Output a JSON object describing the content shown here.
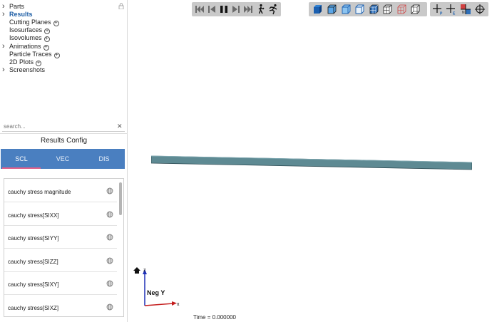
{
  "tree": [
    {
      "label": "Parts",
      "caret": true,
      "bold": false,
      "plus": false
    },
    {
      "label": "Results",
      "caret": true,
      "bold": true,
      "plus": false
    },
    {
      "label": "Cutting Planes",
      "caret": false,
      "bold": false,
      "plus": true
    },
    {
      "label": "Isosurfaces",
      "caret": false,
      "bold": false,
      "plus": true
    },
    {
      "label": "Isovolumes",
      "caret": false,
      "bold": false,
      "plus": true
    },
    {
      "label": "Animations",
      "caret": true,
      "bold": false,
      "plus": true
    },
    {
      "label": "Particle Traces",
      "caret": false,
      "bold": false,
      "plus": true
    },
    {
      "label": "2D Plots",
      "caret": false,
      "bold": false,
      "plus": true
    },
    {
      "label": "Screenshots",
      "caret": true,
      "bold": false,
      "plus": false
    }
  ],
  "search": {
    "placeholder": "search...",
    "clear": "✕"
  },
  "results_config": {
    "title": "Results Config",
    "tabs": [
      "SCL",
      "VEC",
      "DIS"
    ],
    "active_tab": "SCL",
    "items": [
      "cauchy stress magnitude",
      "cauchy stress[SIXX]",
      "cauchy stress[SIYY]",
      "cauchy stress[SIZZ]",
      "cauchy stress[SIXY]",
      "cauchy stress[SIXZ]"
    ]
  },
  "viewport": {
    "time_label": "Time = 0.000000",
    "view_label": "Neg Y",
    "axis_z": "z",
    "axis_x": "x",
    "beam_color": "#5e8a93"
  },
  "toolbar": {
    "playback": [
      "first-frame-icon",
      "previous-frame-icon",
      "pause-icon",
      "next-frame-icon",
      "last-frame-icon",
      "walk-icon",
      "run-icon"
    ],
    "display": [
      "shaded-cube-icon",
      "shaded-edges-cube-icon",
      "outline-cube-icon",
      "hidden-line-cube-icon",
      "mesh-cube-icon",
      "mesh-outline-cube-icon",
      "wireframe-cube-icon",
      "transparent-cube-icon"
    ],
    "probes": [
      "probe-point-icon",
      "probe-element-icon",
      "probe-node-icon",
      "pick-center-icon"
    ]
  }
}
